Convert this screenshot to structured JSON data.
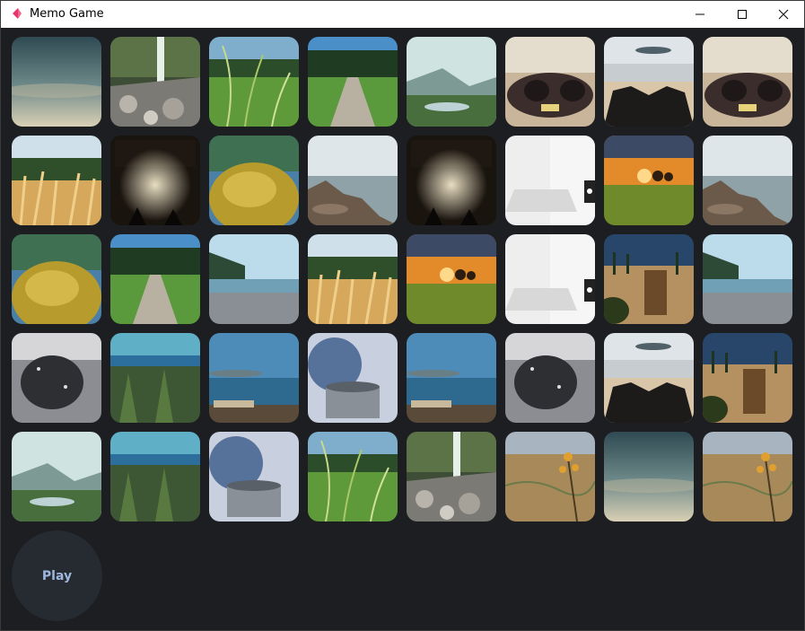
{
  "window": {
    "title": "Memo Game",
    "icon": "memo-game-app-icon",
    "controls": [
      "minimize-icon",
      "maximize-icon",
      "close-icon"
    ]
  },
  "board": {
    "columns": 8,
    "rows": 5,
    "tiles": [
      [
        "sky-clouds",
        "waterfall-rocks",
        "grass-closeup",
        "forest-path",
        "misty-lake",
        "vintage-car",
        "rocky-beach",
        "vintage-car"
      ],
      [
        "wheat-field",
        "concert-crowd",
        "moss-mound",
        "seaside-rocks",
        "concert-crowd",
        "white-laptop",
        "sunset-meadow",
        "seaside-rocks"
      ],
      [
        "moss-mound",
        "forest-path",
        "pebble-beach",
        "wheat-field",
        "sunset-meadow",
        "white-laptop",
        "cypress-villa",
        "pebble-beach"
      ],
      [
        "wet-pavement",
        "sea-shrubs",
        "coast-driftwood",
        "steaming-cup",
        "coast-driftwood",
        "wet-pavement",
        "rocky-beach",
        "cypress-villa"
      ],
      [
        "misty-lake",
        "sea-shrubs",
        "steaming-cup",
        "grass-closeup",
        "waterfall-rocks",
        "thistle-valley",
        "sky-clouds",
        "thistle-valley"
      ]
    ]
  },
  "play_button": {
    "label": "Play"
  }
}
